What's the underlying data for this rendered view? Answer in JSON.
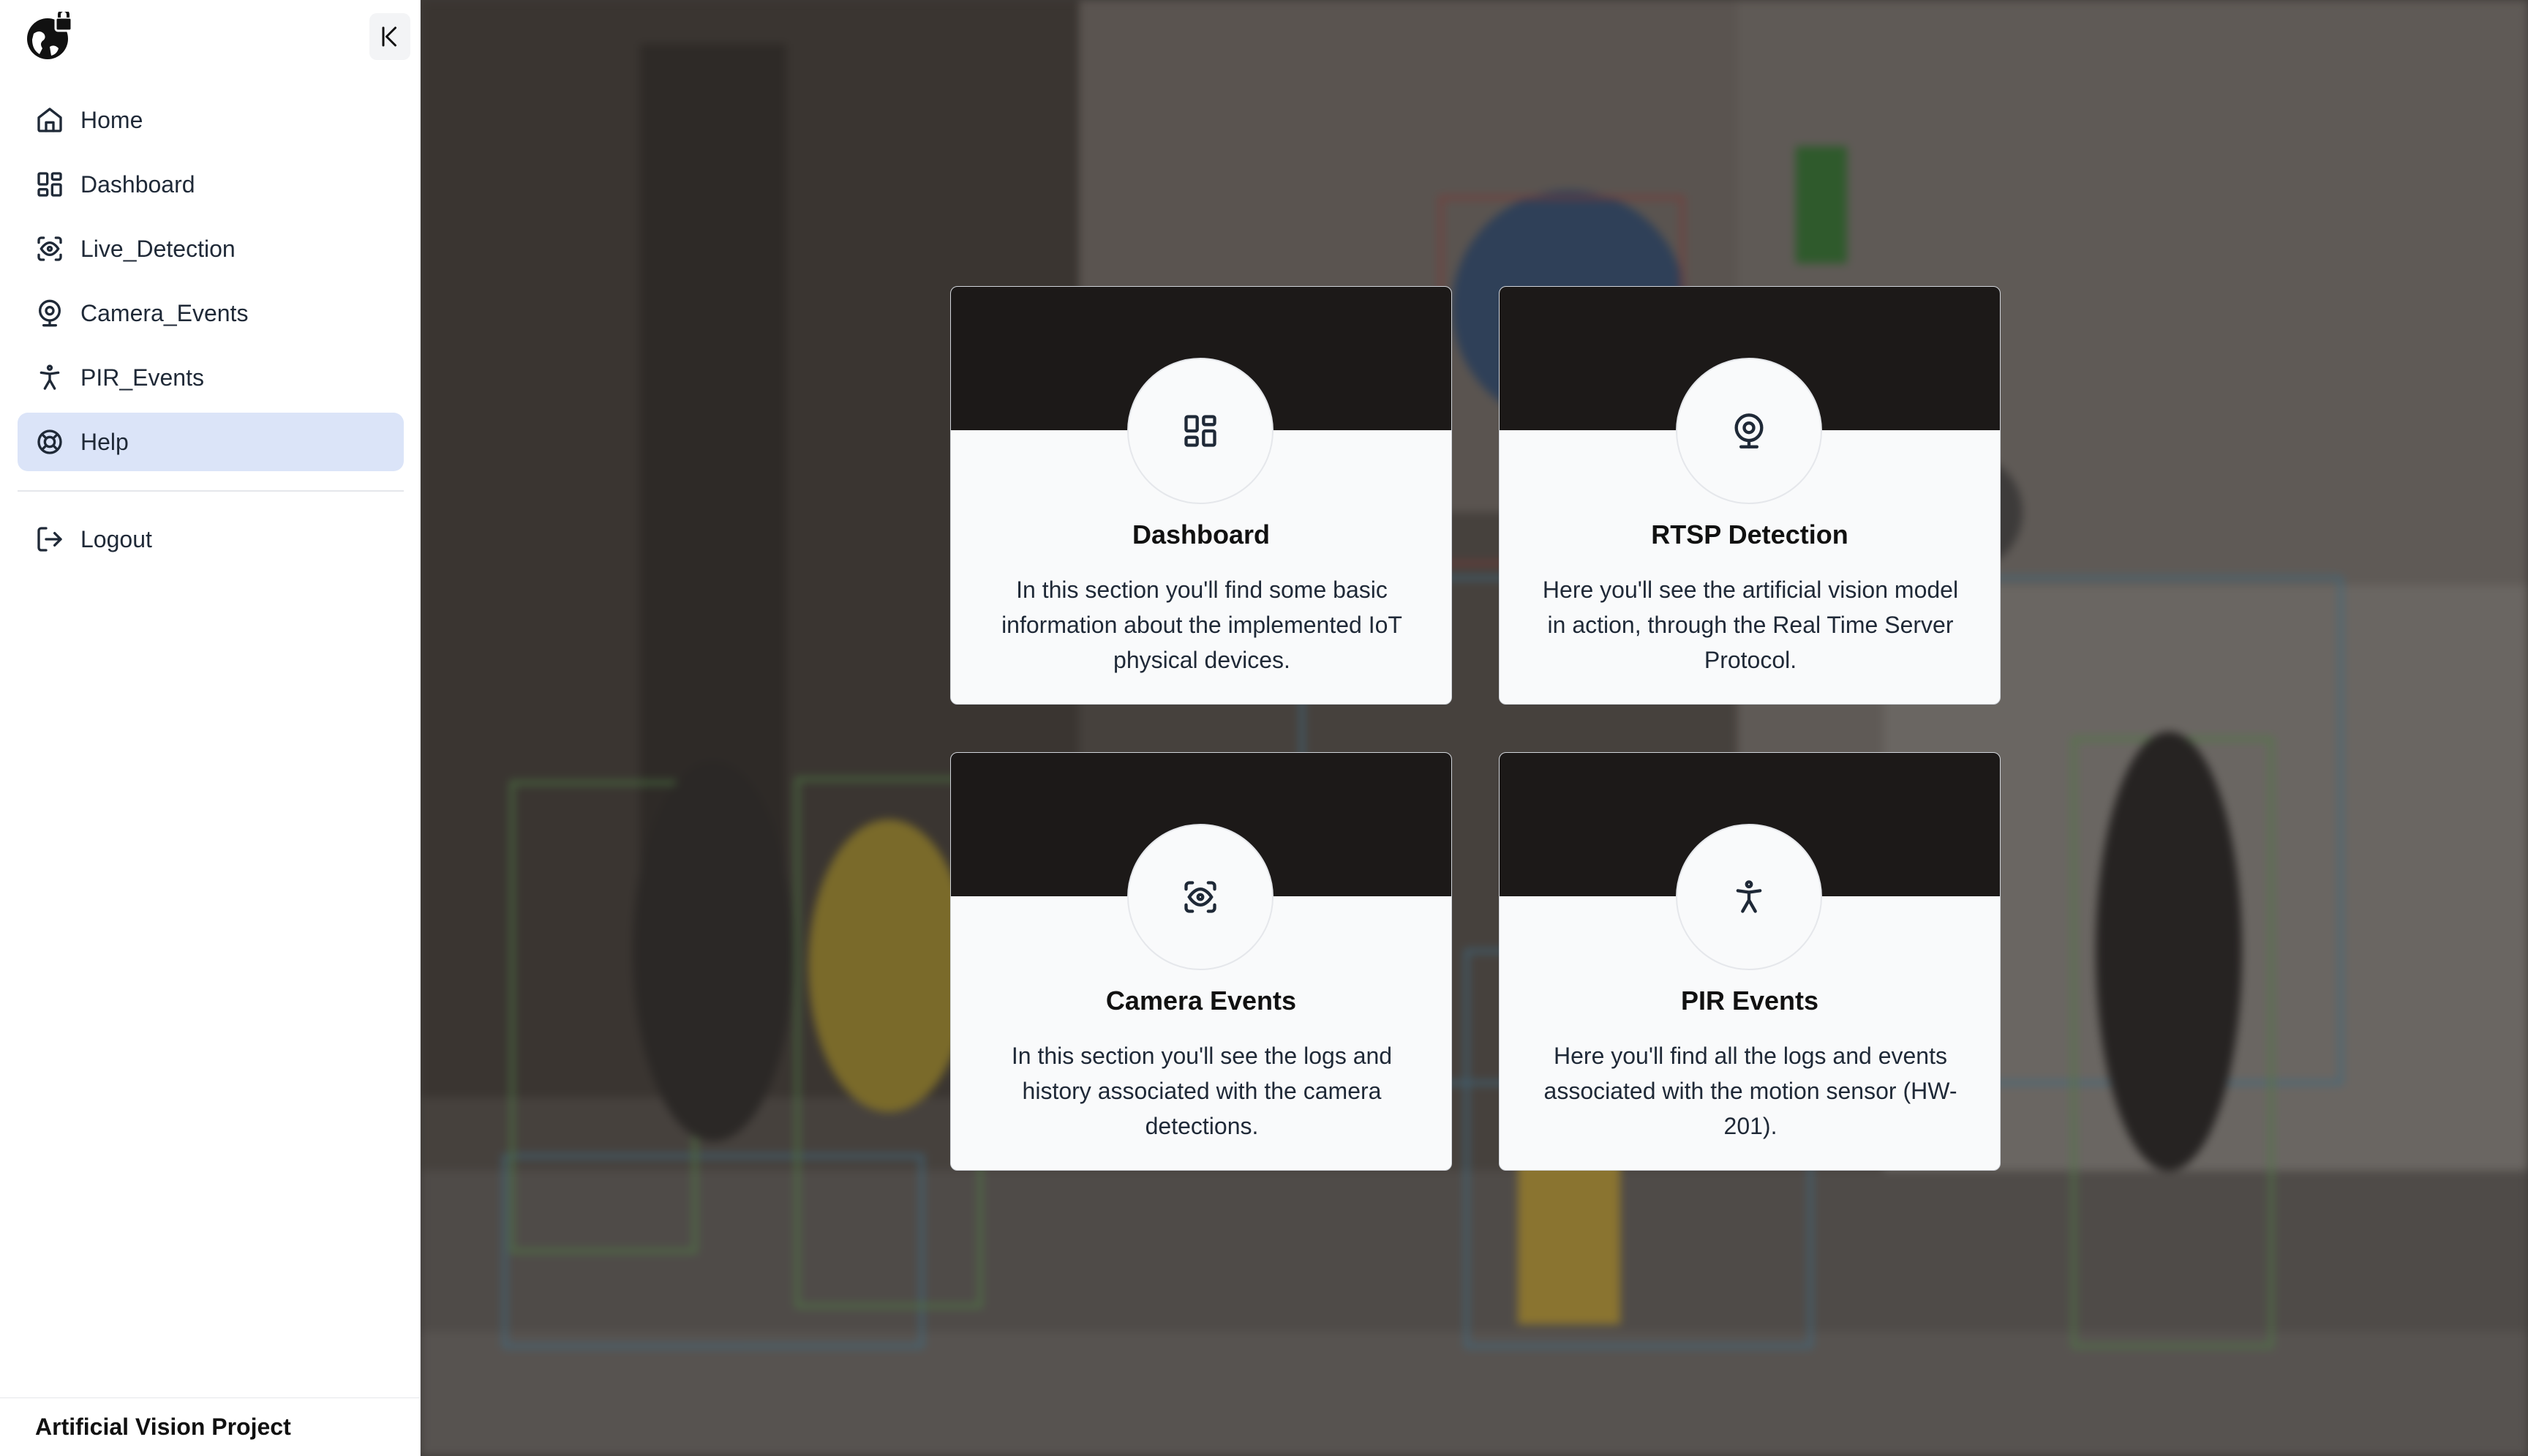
{
  "sidebar": {
    "logo_icon": "globe-lock-icon",
    "collapse_icon": "collapse-left-icon",
    "items": [
      {
        "label": "Home",
        "icon": "home-icon"
      },
      {
        "label": "Dashboard",
        "icon": "dashboard-icon"
      },
      {
        "label": "Live_Detection",
        "icon": "scan-eye-icon"
      },
      {
        "label": "Camera_Events",
        "icon": "webcam-icon"
      },
      {
        "label": "PIR_Events",
        "icon": "accessibility-icon"
      },
      {
        "label": "Help",
        "icon": "lifebuoy-icon",
        "active": true
      }
    ],
    "logout": {
      "label": "Logout",
      "icon": "logout-icon"
    },
    "footer": "Artificial Vision Project"
  },
  "cards": [
    {
      "title": "Dashboard",
      "description": "In this section you'll find some basic information about the implemented IoT physical devices.",
      "icon": "dashboard-icon"
    },
    {
      "title": "RTSP Detection",
      "description": "Here you'll see the artificial vision model in action, through the Real Time Server Protocol.",
      "icon": "webcam-icon"
    },
    {
      "title": "Camera Events",
      "description": "In this section you'll see the logs and history associated with the camera detections.",
      "icon": "scan-eye-icon"
    },
    {
      "title": "PIR Events",
      "description": "Here you'll find all the logs and events associated with the motion sensor (HW-201).",
      "icon": "accessibility-icon"
    }
  ],
  "colors": {
    "active_nav_bg": "#dbe4f8",
    "card_banner": "#1c1918",
    "card_bg": "#f9fafb"
  }
}
